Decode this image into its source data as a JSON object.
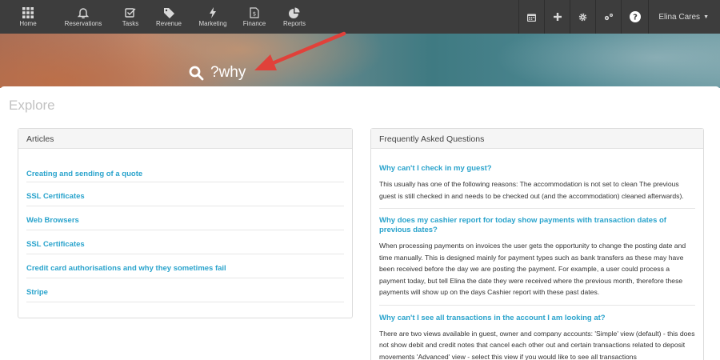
{
  "nav": {
    "items": [
      {
        "label": "Home",
        "icon": "grid-icon"
      },
      {
        "label": "Reservations",
        "icon": "bell-icon"
      },
      {
        "label": "Tasks",
        "icon": "checkbox-icon"
      },
      {
        "label": "Revenue",
        "icon": "tag-icon"
      },
      {
        "label": "Marketing",
        "icon": "bolt-icon"
      },
      {
        "label": "Finance",
        "icon": "dollar-file-icon"
      },
      {
        "label": "Reports",
        "icon": "pie-chart-icon"
      }
    ],
    "tools": [
      "calendar-icon",
      "plus-icon",
      "gear-icon",
      "gears-icon",
      "help-icon"
    ],
    "user_name": "Elina Cares"
  },
  "hero": {
    "search_query": "?why"
  },
  "page": {
    "title": "Explore"
  },
  "articles": {
    "heading": "Articles",
    "items": [
      "Creating and sending of a quote",
      "SSL Certificates",
      "Web Browsers",
      "SSL Certificates",
      "Credit card authorisations and why they sometimes fail",
      "Stripe"
    ]
  },
  "faq": {
    "heading": "Frequently Asked Questions",
    "items": [
      {
        "question": "Why can't I check in my guest?",
        "answer": "This usually has one of the following reasons:  The accommodation is not set to clean The previous guest is still checked in and needs to be checked out (and the accommodation) cleaned afterwards)."
      },
      {
        "question": "Why does my cashier report for today show payments with transaction dates of previous dates?",
        "answer": "When processing payments on invoices the user gets the opportunity to change the posting date and time manually. This is designed mainly for payment types such as bank transfers as these may have been received before the day we are posting the payment.  For example, a user could process a payment today, but tell Elina the date they were received where the previous month, therefore these payments will show up on the days Cashier report with these past dates."
      },
      {
        "question": "Why can't I see all transactions in the account I am looking at?",
        "answer": "There are two views available in guest, owner and company accounts:  'Simple' view (default) - this does not show debit and credit notes that cancel each other out and certain transactions related to deposit movements 'Advanced' view - select this view if you would like to see all transactions"
      }
    ]
  },
  "colors": {
    "nav_bg": "#3d3d3d",
    "link": "#29a3cc",
    "annotation_arrow": "#e0413a"
  }
}
